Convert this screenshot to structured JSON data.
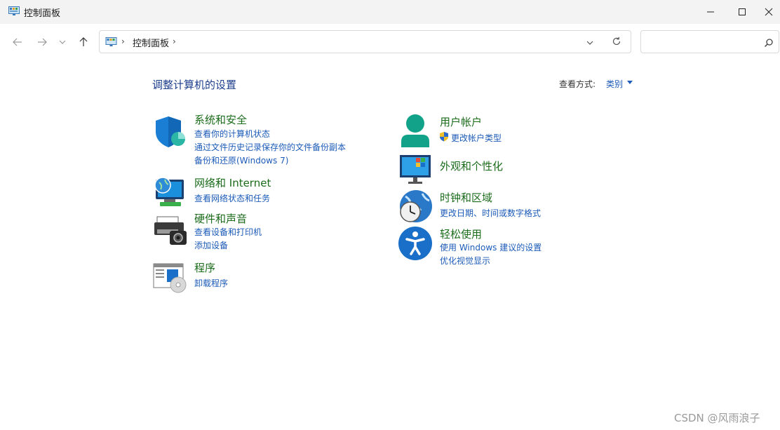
{
  "window": {
    "title": "控制面板"
  },
  "address": {
    "crumb": "控制面板",
    "separator": "›"
  },
  "search": {
    "placeholder": ""
  },
  "main": {
    "heading": "调整计算机的设置",
    "view_by_label": "查看方式:",
    "view_by_value": "类别"
  },
  "categories": [
    {
      "title": "系统和安全",
      "links": [
        "查看你的计算机状态",
        "通过文件历史记录保存你的文件备份副本",
        "备份和还原(Windows 7)"
      ]
    },
    {
      "title": "网络和 Internet",
      "links": [
        "查看网络状态和任务"
      ]
    },
    {
      "title": "硬件和声音",
      "links": [
        "查看设备和打印机",
        "添加设备"
      ]
    },
    {
      "title": "程序",
      "links": [
        "卸载程序"
      ]
    },
    {
      "title": "用户帐户",
      "links": [
        "更改帐户类型"
      ]
    },
    {
      "title": "外观和个性化",
      "links": []
    },
    {
      "title": "时钟和区域",
      "links": [
        "更改日期、时间或数字格式"
      ]
    },
    {
      "title": "轻松使用",
      "links": [
        "使用 Windows 建议的设置",
        "优化视觉显示"
      ]
    }
  ],
  "watermark": "CSDN @风雨浪子",
  "colors": {
    "title_green": "#1a6b1a",
    "link_blue": "#1c5bb8",
    "heading_blue": "#1c3e8c"
  }
}
